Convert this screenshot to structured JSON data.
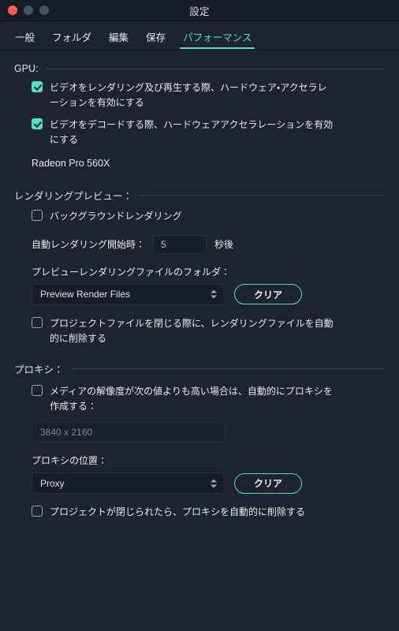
{
  "window": {
    "title": "設定",
    "traffic_lights": [
      {
        "name": "close",
        "color": "#ff5f52"
      },
      {
        "name": "minimize",
        "color": "#4a525e"
      },
      {
        "name": "maximize",
        "color": "#4a525e"
      }
    ]
  },
  "theme": {
    "background": "#1d2430",
    "titlebar": "#161c27",
    "accent": "#4fe3c1",
    "text": "#e6eaf0",
    "muted": "#7d879a",
    "field": "#171d28",
    "rule": "#39414f"
  },
  "tabs": [
    {
      "label": "一般",
      "active": false
    },
    {
      "label": "フォルダ",
      "active": false
    },
    {
      "label": "編集",
      "active": false
    },
    {
      "label": "保存",
      "active": false
    },
    {
      "label": "パフォーマンス",
      "active": true
    }
  ],
  "sections": {
    "gpu": {
      "heading": "GPU:",
      "checkbox_render": {
        "label": "ビデオをレンダリング及び再生する際、ハードウェア・アクセラレーションを有効にする",
        "checked": true
      },
      "checkbox_decode": {
        "label": "ビデオをデコードする際、ハードウェアアクセラレーションを有効にする",
        "checked": true
      },
      "device_name": "Radeon Pro 560X"
    },
    "render_preview": {
      "heading": "レンダリングプレビュー：",
      "checkbox_background": {
        "label": "バックグラウンドレンダリング",
        "checked": false
      },
      "auto_render_label": "自動レンダリング開始時：",
      "auto_render_value": "5",
      "auto_render_unit": "秒後",
      "folder_label": "プレビューレンダリングファイルのフォルダ：",
      "folder_value": "Preview Render Files",
      "clear_button": "クリア",
      "checkbox_autodelete": {
        "label": "プロジェクトファイルを閉じる際に、レンダリングファイルを自動的に削除する",
        "checked": false
      }
    },
    "proxy": {
      "heading": "プロキシ：",
      "checkbox_autocreate": {
        "label": "メディアの解像度が次の値よりも高い場合は、自動的にプロキシを作成する：",
        "checked": false
      },
      "resolution_value": "3840 x 2160",
      "location_label": "プロキシの位置：",
      "location_value": "Proxy",
      "clear_button": "クリア",
      "checkbox_autodelete": {
        "label": "プロジェクトが閉じられたら、プロキシを自動的に削除する",
        "checked": false
      }
    }
  }
}
